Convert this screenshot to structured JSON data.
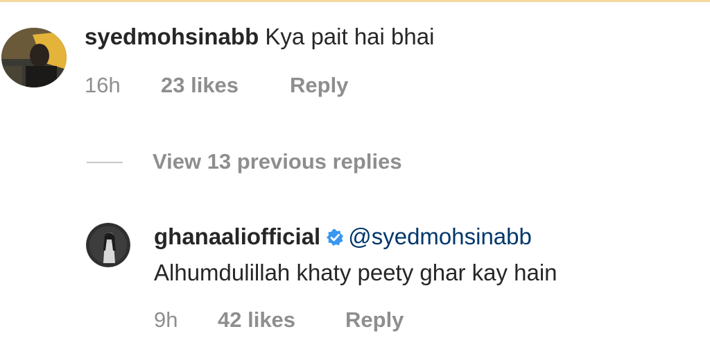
{
  "comment": {
    "username": "syedmohsinabb",
    "text": "Kya pait hai bhai",
    "time": "16h",
    "likes": "23 likes",
    "reply_label": "Reply"
  },
  "view_replies": "View 13 previous replies",
  "reply": {
    "username": "ghanaaliofficial",
    "mention": "@syedmohsinabb",
    "text": "Alhumdulillah khaty peety ghar kay hain",
    "time": "9h",
    "likes": "42 likes",
    "reply_label": "Reply"
  },
  "colors": {
    "text": "#262626",
    "secondary": "#8e8e8e",
    "verified": "#3897f0",
    "mention": "#00376b"
  }
}
